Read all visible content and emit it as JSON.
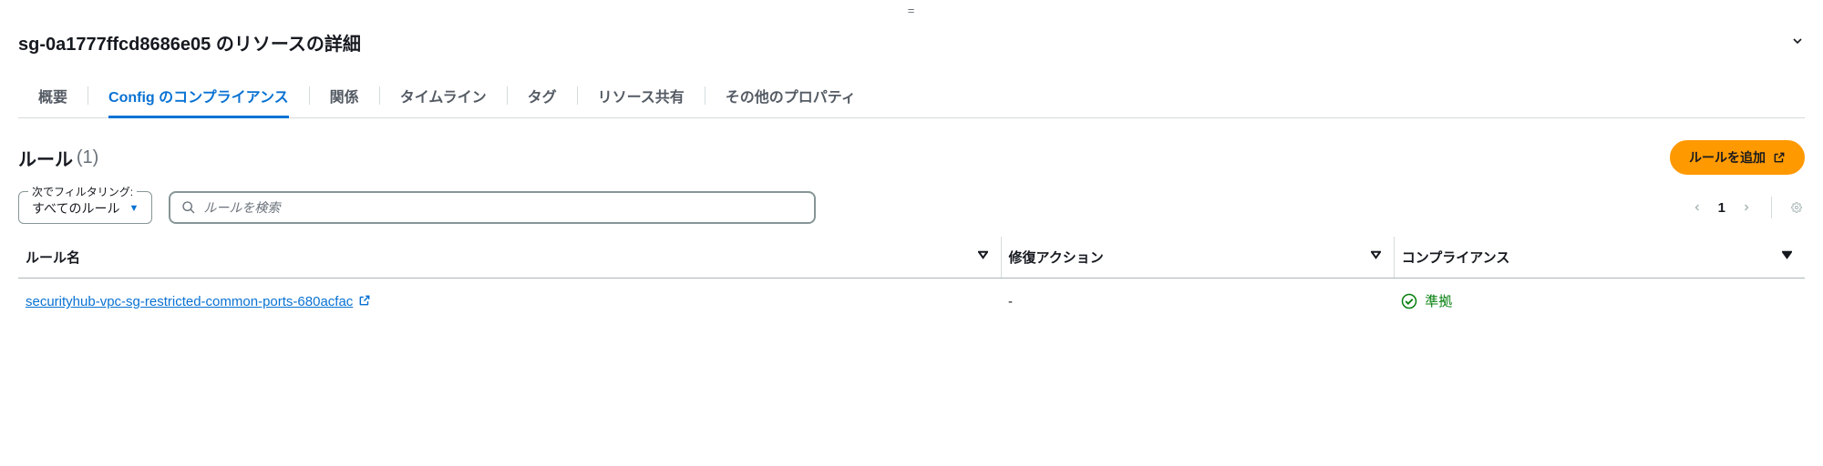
{
  "dragHandle": "=",
  "header": {
    "title": "sg-0a1777ffcd8686e05 のリソースの詳細"
  },
  "tabs": [
    {
      "label": "概要",
      "active": false
    },
    {
      "label": "Config のコンプライアンス",
      "active": true
    },
    {
      "label": "関係",
      "active": false
    },
    {
      "label": "タイムライン",
      "active": false
    },
    {
      "label": "タグ",
      "active": false
    },
    {
      "label": "リソース共有",
      "active": false
    },
    {
      "label": "その他のプロパティ",
      "active": false
    }
  ],
  "rules": {
    "title": "ルール",
    "count": "(1)",
    "addBtn": "ルールを追加"
  },
  "filter": {
    "legend": "次でフィルタリング:",
    "value": "すべてのルール"
  },
  "search": {
    "placeholder": "ルールを検索"
  },
  "pager": {
    "page": "1"
  },
  "columns": {
    "name": "ルール名",
    "remediation": "修復アクション",
    "compliance": "コンプライアンス"
  },
  "rows": [
    {
      "name": "securityhub-vpc-sg-restricted-common-ports-680acfac",
      "remediation": "-",
      "compliance": "準拠"
    }
  ]
}
